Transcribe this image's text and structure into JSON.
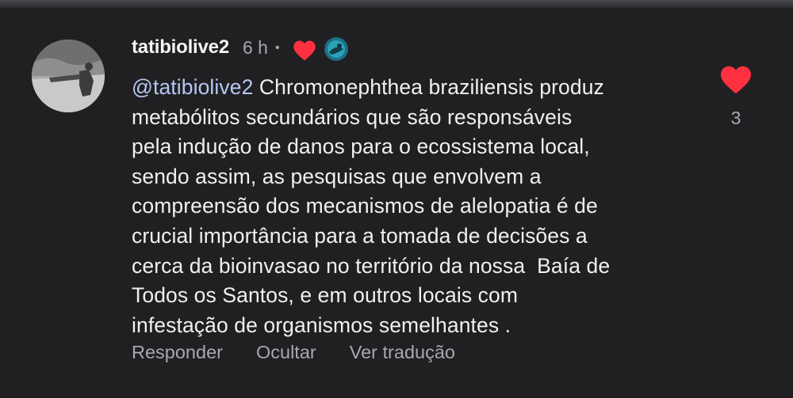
{
  "comment": {
    "username": "tatibiolive2",
    "time": "6 h",
    "separator": "•",
    "mention": "@tatibiolive2",
    "lines": [
      " Chromonephthea braziliensis produz",
      "metabólitos secundários que são responsáveis",
      "pela indução de danos para o ecossistema local,",
      "sendo assim, as pesquisas que envolvem a",
      "compreensão dos mecanismos de alelopatia é de",
      "crucial importância para a tomada de decisões a",
      "cerca da bioinvasao no território da nossa  Baía de",
      "Todos os Santos, e em outros locais com",
      "infestação de organismos semelhantes ."
    ]
  },
  "actions": {
    "reply": "Responder",
    "hide": "Ocultar",
    "translate": "Ver tradução"
  },
  "likes": {
    "count": "3",
    "heart_color": "#ff3040"
  },
  "icons": {
    "avatar": "profile-photo",
    "liked_by_author": "heart-icon",
    "author_avatar": "author-avatar-icon",
    "like": "heart-icon"
  },
  "colors": {
    "background": "#202022",
    "text": "#f0f0f0",
    "muted": "#a8a8ad",
    "mention": "#b6c7f2"
  }
}
